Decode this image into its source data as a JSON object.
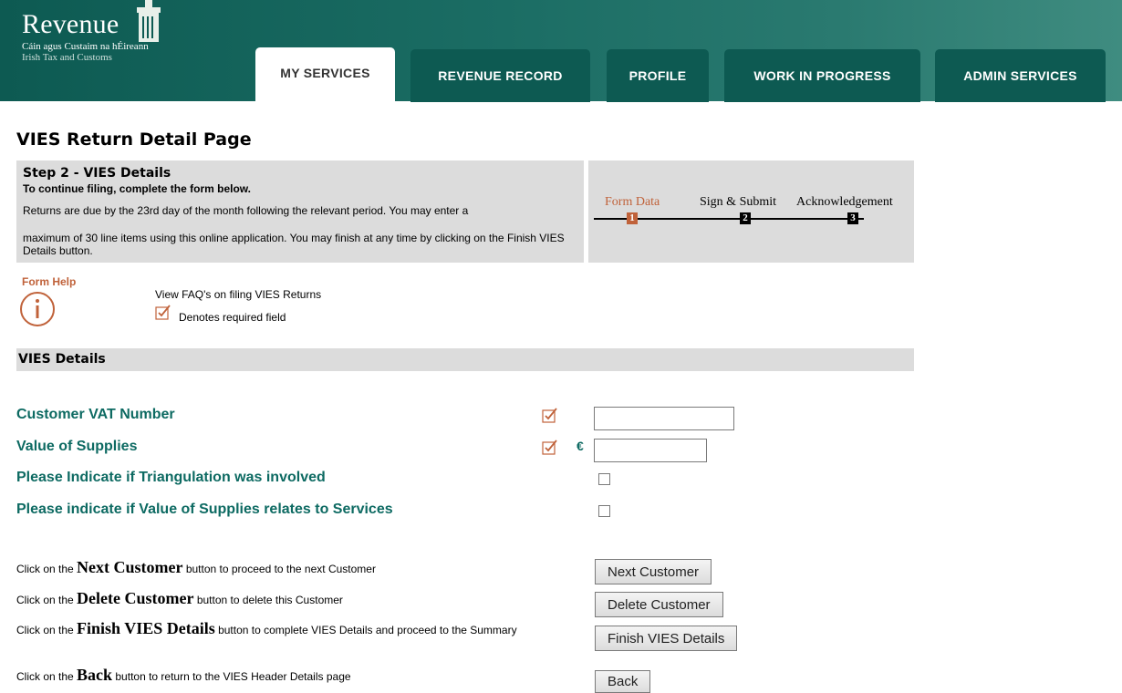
{
  "logo": {
    "name": "Revenue",
    "line1": "Cáin agus Custaim na hÉireann",
    "line2": "Irish Tax and Customs"
  },
  "tabs": [
    {
      "label": "MY SERVICES",
      "active": true
    },
    {
      "label": "REVENUE RECORD",
      "active": false
    },
    {
      "label": "PROFILE",
      "active": false
    },
    {
      "label": "WORK IN PROGRESS",
      "active": false
    },
    {
      "label": "ADMIN SERVICES",
      "active": false
    }
  ],
  "page_title": "VIES Return Detail Page",
  "step": {
    "title": "Step 2 - VIES Details",
    "subtitle": "To continue filing, complete the form below.",
    "para1": "Returns are due by the 23rd day of the month following the relevant period. You may enter a",
    "para2": "maximum of 30 line items using this online application. You may finish at any time by clicking on the Finish VIES Details button."
  },
  "progress": [
    {
      "label": "Form Data",
      "number": "1",
      "active": true
    },
    {
      "label": "Sign & Submit",
      "number": "2",
      "active": false
    },
    {
      "label": "Acknowledgement",
      "number": "3",
      "active": false
    }
  ],
  "help": {
    "title": "Form Help",
    "faq_link": "View FAQ's on filing VIES Returns",
    "required_note": "Denotes required field"
  },
  "section_title": "VIES Details",
  "fields": {
    "customer_vat": {
      "label": "Customer VAT Number",
      "value": "",
      "required": true
    },
    "value_of_supplies": {
      "label": "Value of Supplies",
      "currency": "€",
      "value": "",
      "required": true
    },
    "triangulation": {
      "label": "Please Indicate if Triangulation was involved",
      "checked": false
    },
    "services": {
      "label": "Please indicate if Value of Supplies relates to Services",
      "checked": false
    }
  },
  "instructions": [
    {
      "pre": "Click on the ",
      "bold": "Next Customer",
      "post": " button to proceed to the next Customer",
      "button": "Next Customer"
    },
    {
      "pre": "Click on the ",
      "bold": "Delete Customer",
      "post": " button to delete this Customer",
      "button": "Delete Customer"
    },
    {
      "pre": "Click on the ",
      "bold": "Finish VIES Details",
      "post": " button to complete VIES Details and proceed to the Summary",
      "button": "Finish VIES Details"
    },
    {
      "pre": "Click on the ",
      "bold": "Back",
      "post": " button to return to the VIES Header Details page",
      "button": "Back"
    }
  ],
  "colors": {
    "header_teal": "#0d5a52",
    "label_teal": "#0d6a62",
    "accent_orange": "#c0623a",
    "panel_grey": "#dcdcdc"
  }
}
